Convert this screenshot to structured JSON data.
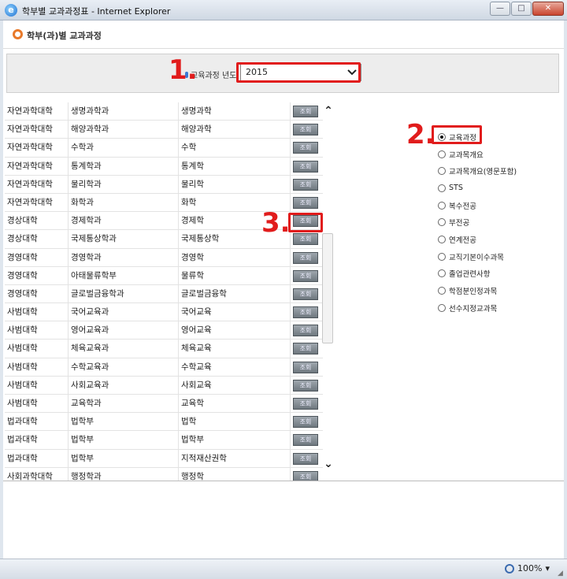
{
  "window": {
    "title": "학부별 교과과정표 - Internet Explorer",
    "minimize": "—",
    "maximize": "□",
    "close": "✕"
  },
  "page": {
    "title": "학부(과)별 교과과정"
  },
  "search": {
    "year_label": "교육과정 년도",
    "year_value": "2015"
  },
  "annotations": {
    "one": "1.",
    "two": "2.",
    "three": "3."
  },
  "table": {
    "button_label": "조회",
    "rows": [
      [
        "자연과학대학",
        "생명과학과",
        "생명과학"
      ],
      [
        "자연과학대학",
        "해양과학과",
        "해양과학"
      ],
      [
        "자연과학대학",
        "수학과",
        "수학"
      ],
      [
        "자연과학대학",
        "통계학과",
        "통계학"
      ],
      [
        "자연과학대학",
        "물리학과",
        "물리학"
      ],
      [
        "자연과학대학",
        "화학과",
        "화학"
      ],
      [
        "경상대학",
        "경제학과",
        "경제학"
      ],
      [
        "경상대학",
        "국제통상학과",
        "국제통상학"
      ],
      [
        "경영대학",
        "경영학과",
        "경영학"
      ],
      [
        "경영대학",
        "아태물류학부",
        "물류학"
      ],
      [
        "경영대학",
        "글로벌금융학과",
        "글로벌금융학"
      ],
      [
        "사범대학",
        "국어교육과",
        "국어교육"
      ],
      [
        "사범대학",
        "영어교육과",
        "영어교육"
      ],
      [
        "사범대학",
        "체육교육과",
        "체육교육"
      ],
      [
        "사범대학",
        "수학교육과",
        "수학교육"
      ],
      [
        "사범대학",
        "사회교육과",
        "사회교육"
      ],
      [
        "사범대학",
        "교육학과",
        "교육학"
      ],
      [
        "법과대학",
        "법학부",
        "법학"
      ],
      [
        "법과대학",
        "법학부",
        "법학부"
      ],
      [
        "법과대학",
        "법학부",
        "지적재산권학"
      ],
      [
        "사회과학대학",
        "행정학과",
        "행정학"
      ]
    ]
  },
  "options": [
    {
      "label": "교육과정",
      "checked": true
    },
    {
      "label": "교과목개요",
      "checked": false
    },
    {
      "label": "교과목개요(영문포함)",
      "checked": false
    },
    {
      "label": "STS",
      "checked": false
    },
    {
      "label": "복수전공",
      "checked": false
    },
    {
      "label": "부전공",
      "checked": false
    },
    {
      "label": "연계전공",
      "checked": false
    },
    {
      "label": "교직기본이수과목",
      "checked": false
    },
    {
      "label": "졸업관련사항",
      "checked": false
    },
    {
      "label": "학점분인정과목",
      "checked": false
    },
    {
      "label": "선수지정교과목",
      "checked": false
    }
  ],
  "status": {
    "zoom": "100%"
  },
  "colors": {
    "annotation": "#e11c1c",
    "accent": "#e8792a"
  }
}
